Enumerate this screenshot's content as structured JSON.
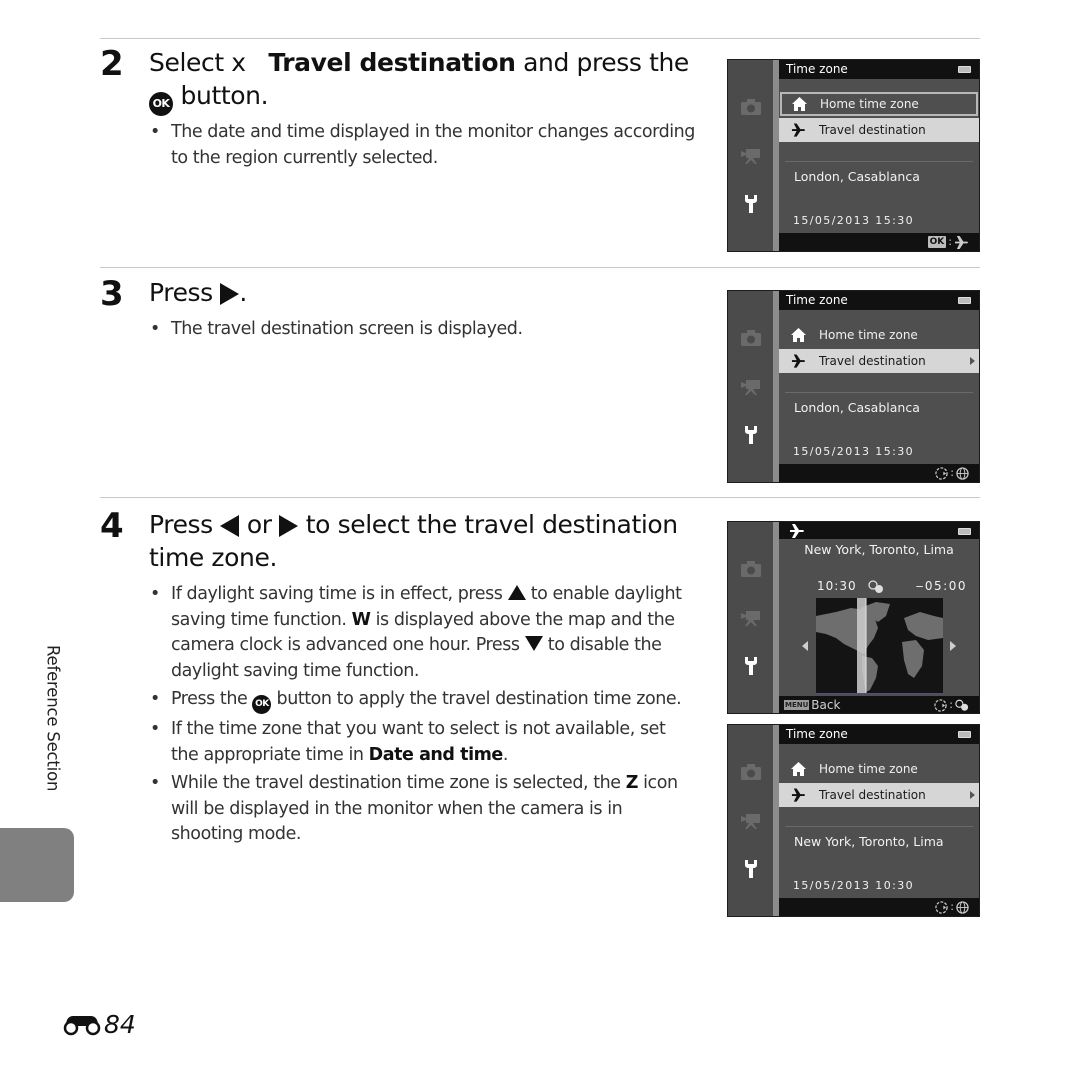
{
  "steps": [
    {
      "number": "2",
      "title_pre": "Select x",
      "title_bold": "Travel destination",
      "title_mid": "and press the",
      "title_ok_glyph": "OK",
      "title_post": "button.",
      "bullets": [
        "The date and time displayed in the monitor changes according to the region currently selected."
      ]
    },
    {
      "number": "3",
      "title_pre": "Press",
      "title_post": ".",
      "bullets": [
        "The travel destination screen is displayed."
      ]
    },
    {
      "number": "4",
      "title_pre": "Press",
      "title_mid": "or",
      "title_post": "to select the travel destination time zone.",
      "bullets": {
        "b1_a": "If daylight saving time is in effect, press",
        "b1_b": "to enable daylight saving time function.",
        "b1_sym": "W",
        "b1_c": "is displayed above the map and the camera clock is advanced one hour. Press",
        "b1_d": "to disable the daylight saving time function.",
        "b2_a": "Press the",
        "b2_ok": "OK",
        "b2_b": "button to apply the travel destination time zone.",
        "b3_a": "If the time zone that you want to select is not available, set the appropriate time in",
        "b3_bold": "Date and time",
        "b3_b": ".",
        "b4_a": "While the travel destination time zone is selected, the",
        "b4_sym": "Z",
        "b4_b": "icon will be displayed in the monitor when the camera is in shooting mode."
      }
    }
  ],
  "screens": {
    "s1": {
      "title": "Time zone",
      "items": [
        "Home time zone",
        "Travel destination"
      ],
      "selected": "Travel destination",
      "city": "London, Casablanca",
      "datetime": "15/05/2013  15:30",
      "ok_label": "OK",
      "hint_sep": ":"
    },
    "s2": {
      "title": "Time zone",
      "items": [
        "Home time zone",
        "Travel destination"
      ],
      "selected": "Travel destination",
      "city": "London, Casablanca",
      "datetime": "15/05/2013  15:30",
      "hint_sep": ":"
    },
    "s3": {
      "city": "New York, Toronto, Lima",
      "time": "10:30",
      "offset": "‒05:00",
      "menu_label": "MENU",
      "back_label": "Back",
      "hint_sep": ":"
    },
    "s4": {
      "title": "Time zone",
      "items": [
        "Home time zone",
        "Travel destination"
      ],
      "selected": "Travel destination",
      "city": "New York, Toronto, Lima",
      "datetime": "15/05/2013  10:30",
      "hint_sep": ":"
    }
  },
  "side_tab": {
    "label": "Reference Section"
  },
  "page_number": "84",
  "colors": {
    "screen_bg": "#4f4f4f",
    "screen_bar": "#111111",
    "selected_row": "#d6d6d6",
    "tab_gray": "#808080"
  }
}
